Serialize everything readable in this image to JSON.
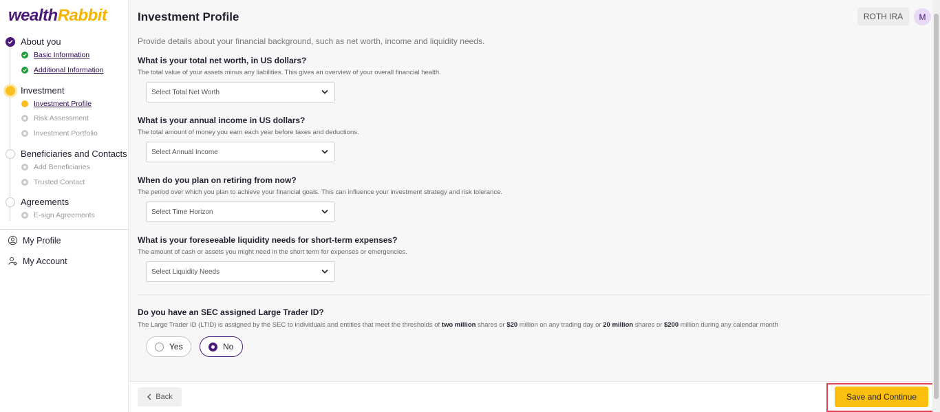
{
  "brand": {
    "part1": "wealth",
    "part2": "Rabbit"
  },
  "sidebar": {
    "stages": [
      {
        "label": "About you",
        "status": "done",
        "items": [
          {
            "label": "Basic Information",
            "status": "done"
          },
          {
            "label": "Additional Information",
            "status": "done"
          }
        ]
      },
      {
        "label": "Investment",
        "status": "active",
        "items": [
          {
            "label": "Investment Profile",
            "status": "active"
          },
          {
            "label": "Risk Assessment",
            "status": "todo"
          },
          {
            "label": "Investment Portfolio",
            "status": "todo"
          }
        ]
      },
      {
        "label": "Beneficiaries and Contacts",
        "status": "todo",
        "items": [
          {
            "label": "Add Beneficiaries",
            "status": "todo"
          },
          {
            "label": "Trusted Contact",
            "status": "todo"
          }
        ]
      },
      {
        "label": "Agreements",
        "status": "todo",
        "items": [
          {
            "label": "E-sign Agreements",
            "status": "todo"
          }
        ]
      }
    ],
    "links": [
      {
        "label": "My Profile",
        "icon": "user-circle-icon"
      },
      {
        "label": "My Account",
        "icon": "user-settings-icon"
      }
    ]
  },
  "header": {
    "title": "Investment Profile",
    "account_type": "ROTH IRA",
    "avatar_initial": "M"
  },
  "intro": "Provide details about your financial background, such as net worth, income and liquidity needs.",
  "questions": [
    {
      "title": "What is your total net worth, in US dollars?",
      "description": "The total value of your assets minus any liabilities. This gives an overview of your overall financial health.",
      "placeholder": "Select Total Net Worth"
    },
    {
      "title": "What is your annual income in US dollars?",
      "description": "The total amount of money you earn each year before taxes and deductions.",
      "placeholder": "Select Annual Income"
    },
    {
      "title": "When do you plan on retiring from now?",
      "description": "The period over which you plan to achieve your financial goals. This can influence your investment strategy and risk tolerance.",
      "placeholder": "Select Time Horizon"
    },
    {
      "title": "What is your foreseeable liquidity needs for short-term expenses?",
      "description": "The amount of cash or assets you might need in the short term for expenses or emergencies.",
      "placeholder": "Select Liquidity Needs"
    }
  ],
  "ltid": {
    "title": "Do you have an SEC assigned Large Trader ID?",
    "desc_1": "The Large Trader ID (LTID) is assigned by the SEC to individuals and entities that meet the thresholds of ",
    "desc_b1": "two million",
    "desc_2": " shares or ",
    "desc_b2": "$20",
    "desc_3": " million on any trading day or ",
    "desc_b3": "20 million",
    "desc_4": " shares or ",
    "desc_b4": "$200",
    "desc_5": " million during any calendar month",
    "options": [
      {
        "label": "Yes",
        "selected": false
      },
      {
        "label": "No",
        "selected": true
      }
    ]
  },
  "footer": {
    "back_label": "Back",
    "save_label": "Save and Continue"
  },
  "colors": {
    "brand_purple": "#4b1a78",
    "accent_yellow": "#fbbf0f",
    "success_green": "#1f9d3a",
    "highlight_red": "#e0434f"
  }
}
